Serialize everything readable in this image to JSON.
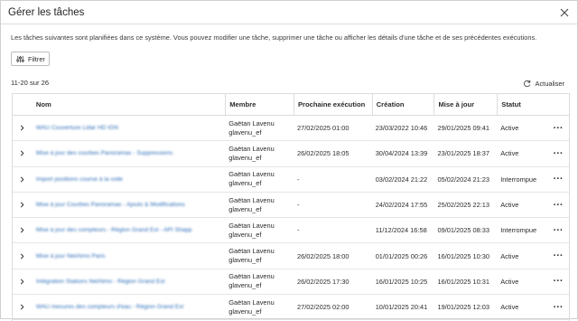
{
  "dialog": {
    "title": "Gérer les tâches",
    "description": "Les tâches suivantes sont planifiées dans ce système. Vous pouvez modifier une tâche, supprimer une tâche ou afficher les détails d'une tâche et de ses précédentes exécutions.",
    "filter_label": "Filtrer",
    "count_label": "11-20 sur 26",
    "refresh_label": "Actualiser"
  },
  "table": {
    "headers": {
      "name": "Nom",
      "member": "Membre",
      "next_run": "Prochaine exécution",
      "created": "Création",
      "updated": "Mise à jour",
      "status": "Statut"
    },
    "rows": [
      {
        "name": "WAU Couverture Lidar HD IGN",
        "member_name": "Gaëtan Lavenu",
        "member_user": "glavenu_ef",
        "next_run": "27/02/2025 01:00",
        "created": "23/03/2022 10:46",
        "updated": "29/01/2025 09:41",
        "status": "Active"
      },
      {
        "name": "Mise à jour des courbes Panoramax - Suppressions",
        "member_name": "Gaëtan Lavenu",
        "member_user": "glavenu_ef",
        "next_run": "26/02/2025 18:05",
        "created": "30/04/2024 13:39",
        "updated": "23/01/2025 18:37",
        "status": "Active"
      },
      {
        "name": "Import positions course à la voile",
        "member_name": "Gaëtan Lavenu",
        "member_user": "glavenu_ef",
        "next_run": "-",
        "created": "03/02/2024 21:22",
        "updated": "05/02/2024 21:23",
        "status": "Interrompue"
      },
      {
        "name": "Mise à jour Courbes Panoramax - Ajouts & Modifications",
        "member_name": "Gaëtan Lavenu",
        "member_user": "glavenu_ef",
        "next_run": "-",
        "created": "24/02/2024 17:55",
        "updated": "25/02/2025 22:13",
        "status": "Active"
      },
      {
        "name": "Mise à jour des compteurs - Région Grand Est - API Shapp",
        "member_name": "Gaëtan Lavenu",
        "member_user": "glavenu_ef",
        "next_run": "-",
        "created": "11/12/2024 16:58",
        "updated": "09/01/2025 08:33",
        "status": "Interrompue"
      },
      {
        "name": "Mise à jour NetAtmo Paris",
        "member_name": "Gaëtan Lavenu",
        "member_user": "glavenu_ef",
        "next_run": "26/02/2025 18:00",
        "created": "01/01/2025 00:26",
        "updated": "16/01/2025 10:30",
        "status": "Active"
      },
      {
        "name": "Intégration Stations NetAtmo - Région Grand Est",
        "member_name": "Gaëtan Lavenu",
        "member_user": "glavenu_ef",
        "next_run": "26/02/2025 17:30",
        "created": "16/01/2025 10:25",
        "updated": "16/01/2025 10:31",
        "status": "Active"
      },
      {
        "name": "WAU mesures des compteurs d'eau - Région Grand Est",
        "member_name": "Gaëtan Lavenu",
        "member_user": "glavenu_ef",
        "next_run": "27/02/2025 02:00",
        "created": "10/01/2025 20:41",
        "updated": "19/01/2025 12:03",
        "status": "Active"
      }
    ]
  },
  "icons": {
    "close": "close-icon",
    "filter": "sliders-icon",
    "refresh": "refresh-icon",
    "expand": "chevron-right-icon",
    "more": "more-horizontal-icon"
  },
  "colors": {
    "link": "#2f6fb8",
    "border": "#dcdcdc"
  }
}
